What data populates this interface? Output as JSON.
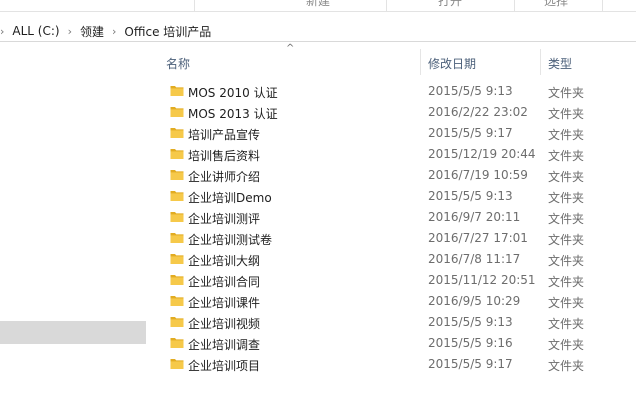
{
  "ribbon": {
    "groups": [
      "",
      "新建",
      "打开",
      "选择"
    ]
  },
  "address": {
    "crumbs": [
      "ALL (C:)",
      "领建",
      "Office 培训产品"
    ]
  },
  "columns": {
    "name": "名称",
    "date": "修改日期",
    "type": "类型"
  },
  "files": [
    {
      "name": "MOS 2010 认证",
      "date": "2015/5/5 9:13",
      "type": "文件夹"
    },
    {
      "name": "MOS 2013 认证",
      "date": "2016/2/22 23:02",
      "type": "文件夹"
    },
    {
      "name": "培训产品宣传",
      "date": "2015/5/5 9:17",
      "type": "文件夹"
    },
    {
      "name": "培训售后资料",
      "date": "2015/12/19 20:44",
      "type": "文件夹"
    },
    {
      "name": "企业讲师介绍",
      "date": "2016/7/19 10:59",
      "type": "文件夹"
    },
    {
      "name": "企业培训Demo",
      "date": "2015/5/5 9:13",
      "type": "文件夹"
    },
    {
      "name": "企业培训测评",
      "date": "2016/9/7 20:11",
      "type": "文件夹"
    },
    {
      "name": "企业培训测试卷",
      "date": "2016/7/27 17:01",
      "type": "文件夹"
    },
    {
      "name": "企业培训大纲",
      "date": "2016/7/8 11:17",
      "type": "文件夹"
    },
    {
      "name": "企业培训合同",
      "date": "2015/11/12 20:51",
      "type": "文件夹"
    },
    {
      "name": "企业培训课件",
      "date": "2016/9/5 10:29",
      "type": "文件夹"
    },
    {
      "name": "企业培训视频",
      "date": "2015/5/5 9:13",
      "type": "文件夹"
    },
    {
      "name": "企业培训调查",
      "date": "2015/5/5 9:16",
      "type": "文件夹"
    },
    {
      "name": "企业培训项目",
      "date": "2015/5/5 9:17",
      "type": "文件夹"
    }
  ],
  "colors": {
    "header_text": "#4c607a",
    "folder_yellow": "#f6c94a",
    "folder_dark": "#e2ac22",
    "nav_selected": "#d9d9d9"
  },
  "icons": {
    "folder": "folder-icon",
    "sort": "sort-ascending-icon",
    "breadcrumb_sep": "chevron-right-icon"
  }
}
